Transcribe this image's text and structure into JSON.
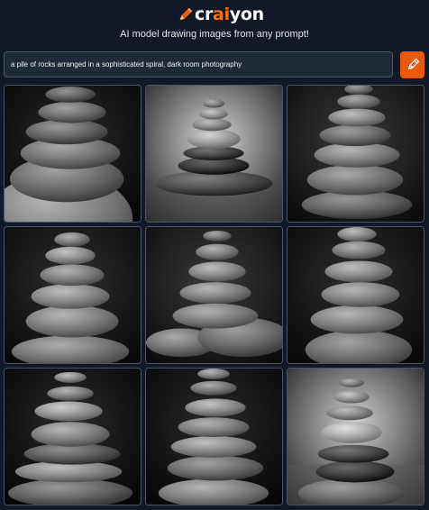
{
  "header": {
    "logo_parts": [
      "cr",
      "ai",
      "yon"
    ],
    "tagline": "AI model drawing images from any prompt!"
  },
  "prompt": {
    "value": "a pile of rocks arranged in a sophisticated spiral, dark room photography"
  },
  "icons": {
    "logo": "pencil-icon",
    "draw_button": "pencil-icon"
  },
  "colors": {
    "background": "#111827",
    "accent": "#ea580c",
    "input_bg": "#1f2937",
    "border": "#4b5563"
  },
  "results": {
    "count": 9,
    "images": [
      {
        "subject": "rock-stack"
      },
      {
        "subject": "rock-stack"
      },
      {
        "subject": "rock-stack"
      },
      {
        "subject": "rock-stack"
      },
      {
        "subject": "rock-stack"
      },
      {
        "subject": "rock-stack"
      },
      {
        "subject": "rock-stack"
      },
      {
        "subject": "rock-stack"
      },
      {
        "subject": "rock-stack"
      }
    ]
  }
}
